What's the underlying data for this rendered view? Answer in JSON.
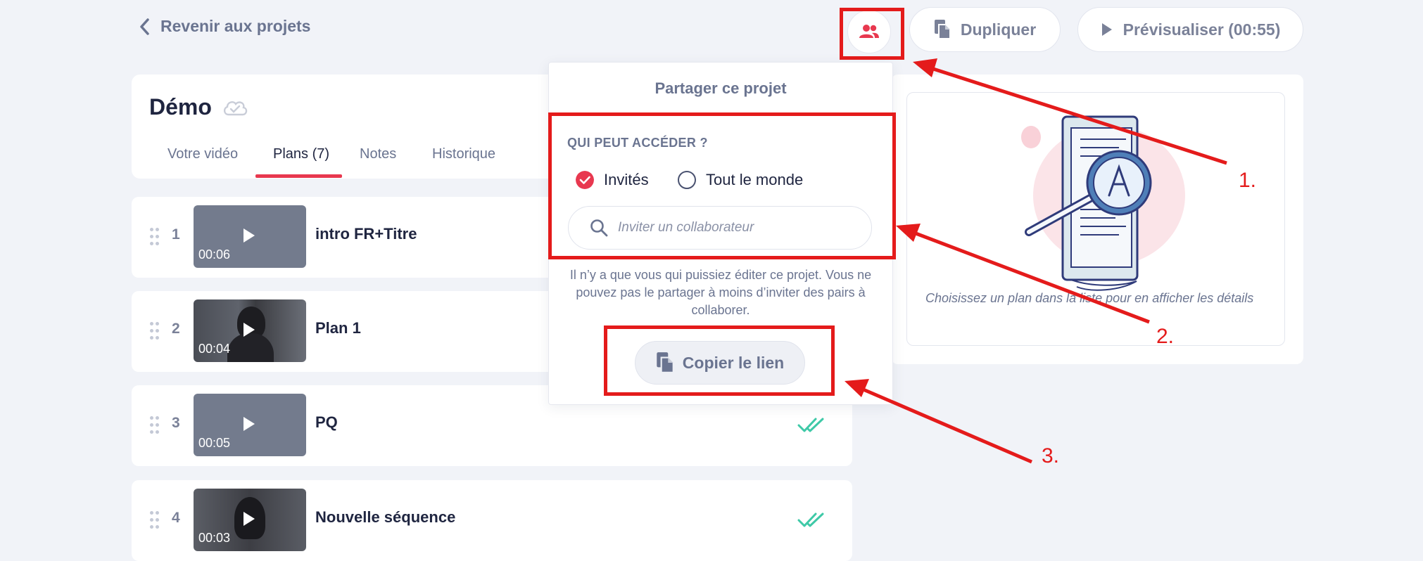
{
  "topbar": {
    "back_label": "Revenir aux projets",
    "duplicate_label": "Dupliquer",
    "preview_label": "Prévisualiser (00:55)"
  },
  "project": {
    "title": "Démo",
    "tabs": [
      {
        "label": "Votre vidéo"
      },
      {
        "label": "Plans (7)"
      },
      {
        "label": "Notes"
      },
      {
        "label": "Historique"
      }
    ],
    "active_tab": "Plans (7)"
  },
  "plans": [
    {
      "number": "1",
      "name": "intro FR+Titre",
      "duration": "00:06",
      "done": false
    },
    {
      "number": "2",
      "name": "Plan 1",
      "duration": "00:04",
      "done": false
    },
    {
      "number": "3",
      "name": "PQ",
      "duration": "00:05",
      "done": true
    },
    {
      "number": "4",
      "name": "Nouvelle séquence",
      "duration": "00:03",
      "done": true
    }
  ],
  "share_popover": {
    "title": "Partager ce projet",
    "access_heading": "QUI PEUT ACCÉDER ?",
    "options": [
      {
        "label": "Invités",
        "selected": true
      },
      {
        "label": "Tout le monde",
        "selected": false
      }
    ],
    "search_placeholder": "Inviter un collaborateur",
    "note": "Il n’y a que vous qui puissiez éditer ce projet. Vous ne pouvez pas le partager à moins d’inviter des pairs à collaborer.",
    "copy_link_label": "Copier le lien"
  },
  "detail_panel": {
    "empty_text": "Choisissez un plan dans la liste pour en afficher les détails"
  },
  "annotations": [
    "1.",
    "2.",
    "3."
  ],
  "colors": {
    "accent": "#e8384f",
    "annotation": "#e41b1b",
    "check": "#3ec9a7",
    "text_dark": "#1f2540",
    "text_muted": "#6a7490"
  }
}
